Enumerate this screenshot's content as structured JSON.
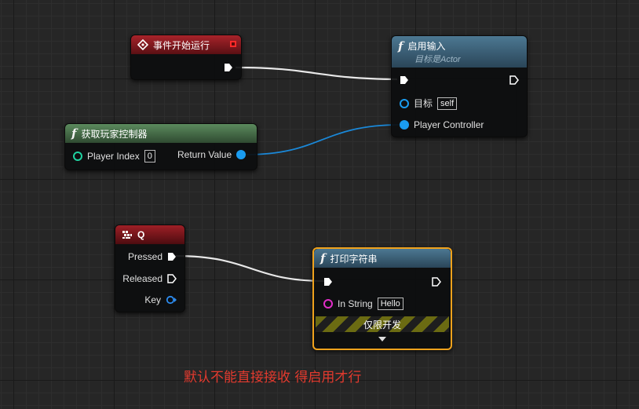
{
  "nodes": {
    "begin_play": {
      "title": "事件开始运行"
    },
    "enable_input": {
      "title": "启用输入",
      "subtitle": "目标是Actor",
      "target_label": "目标",
      "target_value": "self",
      "pc_label": "Player Controller"
    },
    "get_pc": {
      "title": "获取玩家控制器",
      "player_index_label": "Player Index",
      "player_index_value": "0",
      "return_label": "Return Value"
    },
    "key_q": {
      "title": "Q",
      "pressed_label": "Pressed",
      "released_label": "Released",
      "key_label": "Key"
    },
    "print_string": {
      "title": "打印字符串",
      "instring_label": "In String",
      "instring_value": "Hello",
      "dev_only_label": "仅限开发"
    }
  },
  "annotation": "默认不能直接接收 得启用才行",
  "colors": {
    "exec": "#ffffff",
    "object_pin": "#1a9cf0",
    "int_pin": "#1fd2a0",
    "string_pin": "#e22ec8",
    "struct_pin": "#2d8cf0",
    "selection": "#f0a21c",
    "annotation": "#e23a2e"
  }
}
